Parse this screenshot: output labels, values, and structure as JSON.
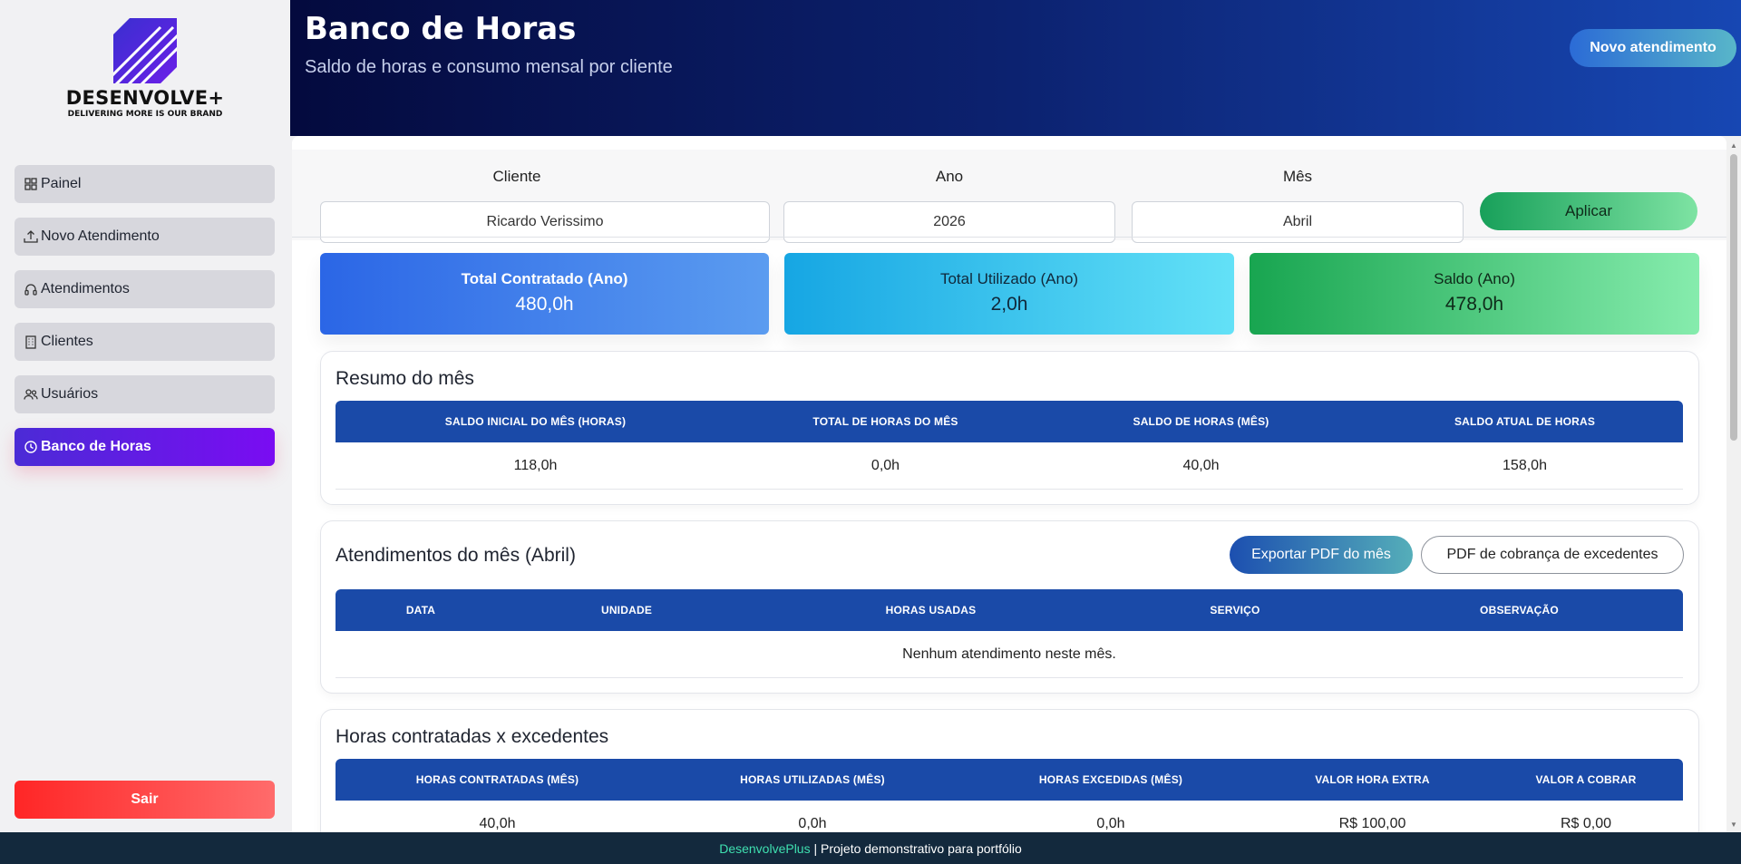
{
  "brand": {
    "name": "DESENVOLVE+",
    "tagline": "DELIVERING MORE IS OUR BRAND"
  },
  "sidebar": {
    "items": [
      {
        "label": "Painel",
        "icon": "grid-icon"
      },
      {
        "label": "Novo Atendimento",
        "icon": "upload-icon"
      },
      {
        "label": "Atendimentos",
        "icon": "headphones-icon"
      },
      {
        "label": "Clientes",
        "icon": "building-icon"
      },
      {
        "label": "Usuários",
        "icon": "users-icon"
      },
      {
        "label": "Banco de Horas",
        "icon": "clock-icon",
        "active": true
      }
    ],
    "logout_label": "Sair"
  },
  "header": {
    "title": "Banco de Horas",
    "subtitle": "Saldo de horas e consumo mensal por cliente",
    "new_button": "Novo atendimento"
  },
  "filters": {
    "client_label": "Cliente",
    "client_value": "Ricardo Verissimo",
    "year_label": "Ano",
    "year_value": "2026",
    "month_label": "Mês",
    "month_value": "Abril",
    "apply_label": "Aplicar"
  },
  "cards": [
    {
      "label": "Total Contratado (Ano)",
      "value": "480,0h"
    },
    {
      "label": "Total Utilizado (Ano)",
      "value": "2,0h"
    },
    {
      "label": "Saldo (Ano)",
      "value": "478,0h"
    }
  ],
  "summary": {
    "title": "Resumo do mês",
    "headers": [
      "SALDO INICIAL DO MÊS (HORAS)",
      "TOTAL DE HORAS DO MÊS",
      "SALDO DE HORAS (MÊS)",
      "SALDO ATUAL DE HORAS"
    ],
    "row": [
      "118,0h",
      "0,0h",
      "40,0h",
      "158,0h"
    ]
  },
  "attendances": {
    "title": "Atendimentos do mês (Abril)",
    "export_label": "Exportar PDF do mês",
    "pdf_label": "PDF de cobrança de excedentes",
    "headers": [
      "DATA",
      "UNIDADE",
      "HORAS USADAS",
      "SERVIÇO",
      "OBSERVAÇÃO"
    ],
    "empty": "Nenhum atendimento neste mês."
  },
  "contracted": {
    "title": "Horas contratadas x excedentes",
    "headers": [
      "HORAS CONTRATADAS (MÊS)",
      "HORAS UTILIZADAS (MÊS)",
      "HORAS EXCEDIDAS (MÊS)",
      "VALOR HORA EXTRA",
      "VALOR A COBRAR"
    ],
    "row": [
      "40,0h",
      "0,0h",
      "0,0h",
      "R$ 100,00",
      "R$ 0,00"
    ]
  },
  "footer": {
    "brand": "DesenvolvePlus",
    "text": " | Projeto demonstrativo para portfólio"
  },
  "colors": {
    "header_dark": "#040a3e",
    "header_light": "#1747b3",
    "table_head": "#1a4aa8",
    "active_nav": "#7a0cf2",
    "logout": "#ff2626",
    "footer": "#13293d"
  }
}
